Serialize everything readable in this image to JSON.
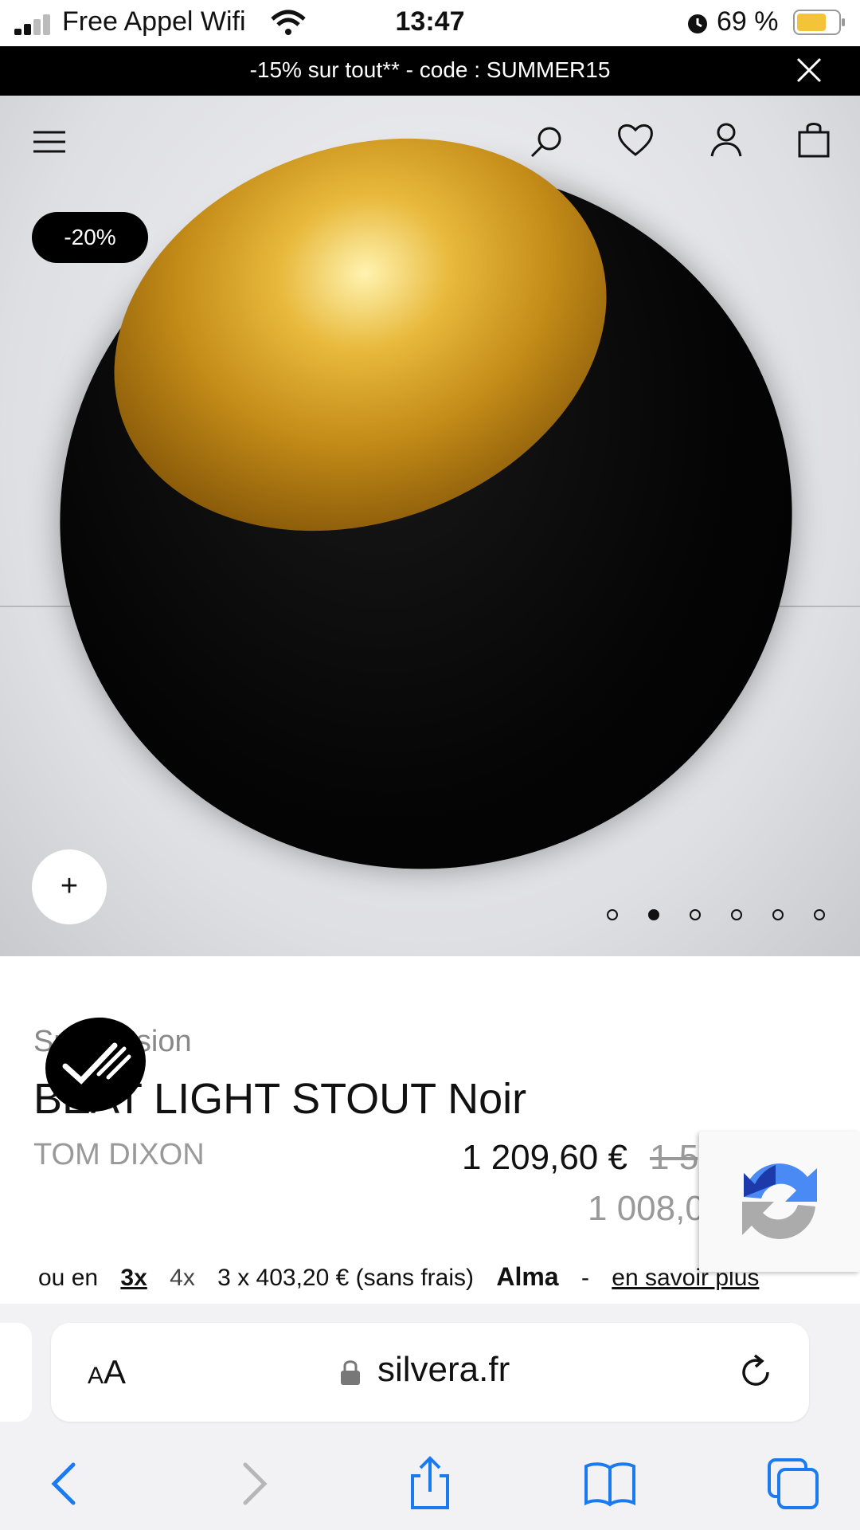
{
  "status_bar": {
    "carrier": "Free Appel Wifi",
    "time": "13:47",
    "battery": "69 %"
  },
  "promo": {
    "text": "-15% sur tout** - code : SUMMER15"
  },
  "hero": {
    "badge": "-20%",
    "zoom_label": "+",
    "slides_total": 6,
    "slide_active": 2
  },
  "product": {
    "category": "Suspension",
    "title": "BEAT LIGHT STOUT Noir",
    "brand": "TOM DIXON",
    "price": "1 209,60 €",
    "old_price": "1 5",
    "price_secondary": "1 008,0"
  },
  "payment": {
    "prefix": "ou en",
    "opt_3x": "3x",
    "opt_4x": "4x",
    "detail": "3 x 403,20 € (sans frais)",
    "provider": "Alma",
    "separator": "-",
    "learn_more": "en savoir plus"
  },
  "safari": {
    "aa": "AA",
    "url": "silvera.fr"
  },
  "colors": {
    "promo_bg": "#000000",
    "accent_blue": "#1a7bf0"
  },
  "icons": [
    "menu-icon",
    "search-icon",
    "heart-icon",
    "user-icon",
    "bag-icon",
    "close-icon",
    "lock-icon",
    "reload-icon",
    "back-icon",
    "forward-icon",
    "share-icon",
    "bookmarks-icon",
    "tabs-icon"
  ]
}
